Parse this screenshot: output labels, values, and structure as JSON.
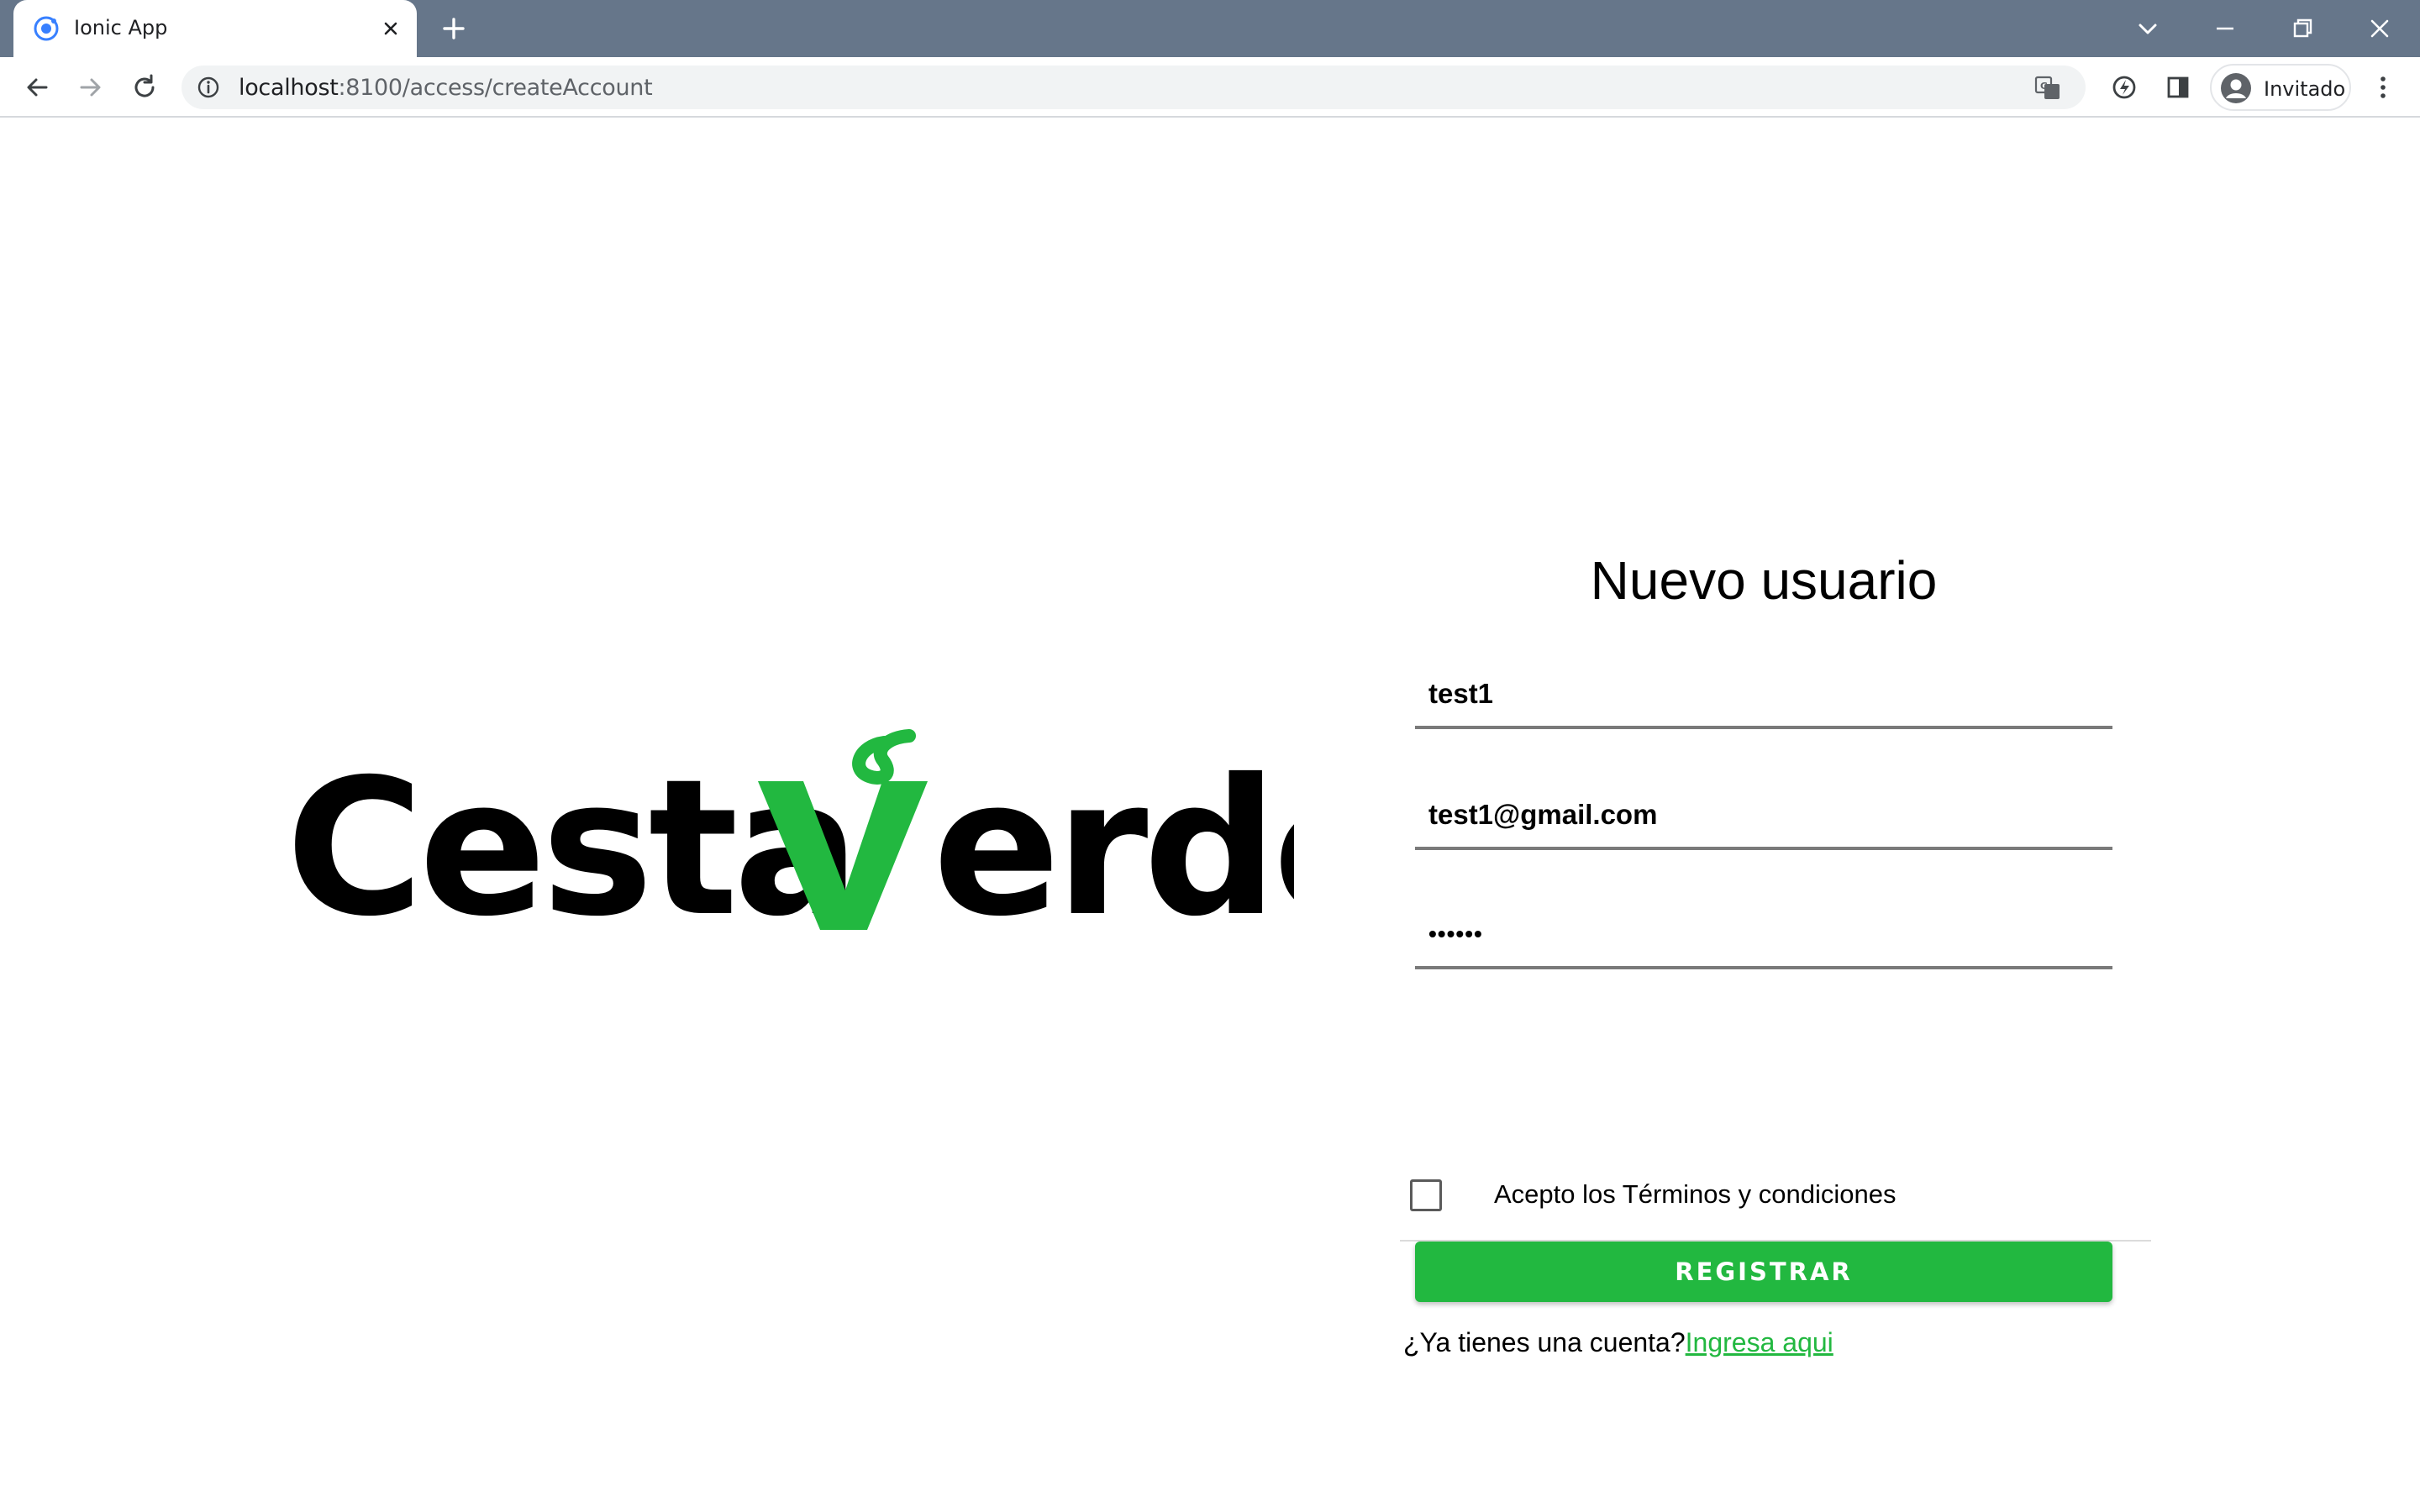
{
  "browser": {
    "tab_title": "Ionic App",
    "url_host": "localhost",
    "url_path": ":8100/access/createAccount",
    "profile_label": "Invitado"
  },
  "logo": {
    "brand": "CestaVerde",
    "brand_part1": "Cesta",
    "brand_part2": "erde",
    "colors": {
      "text": "#000000",
      "accent": "#22b840"
    }
  },
  "form": {
    "title": "Nuevo usuario",
    "username_value": "test1",
    "email_value": "test1@gmail.com",
    "password_value": "••••••",
    "terms_label": "Acepto los Términos y condiciones",
    "terms_checked": false,
    "register_label": "REGISTRAR",
    "login_prompt": "¿Ya tienes una cuenta?",
    "login_link": "Ingresa aqui"
  },
  "colors": {
    "tabstrip": "#66768a",
    "accent": "#22b840"
  },
  "icons": {
    "favicon": "ionic-icon",
    "back": "back-arrow-icon",
    "forward": "forward-arrow-icon",
    "reload": "reload-icon",
    "site_info": "info-icon",
    "translate": "translate-icon",
    "performance": "performance-icon",
    "side_panel": "side-panel-icon",
    "profile": "profile-avatar-icon",
    "menu": "kebab-menu-icon"
  }
}
